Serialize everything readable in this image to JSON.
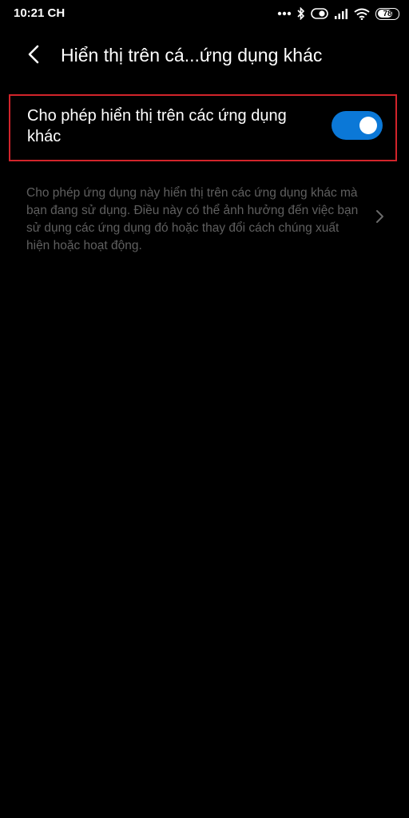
{
  "status_bar": {
    "time": "10:21 CH",
    "battery_level": "78",
    "battery_fraction": 0.78,
    "icons": [
      "more-dots-icon",
      "bluetooth-icon",
      "alarm-toggle-icon",
      "signal-icon",
      "wifi-icon",
      "battery-icon"
    ]
  },
  "header": {
    "back_icon": "chevron-left-icon",
    "title": "Hiển thị trên cá...ứng dụng khác"
  },
  "setting": {
    "label": "Cho phép hiển thị trên các ứng dụng khác",
    "toggle_on": true,
    "toggle_color": "#0b78d7",
    "highlight_color": "#d2242b"
  },
  "description": {
    "text": "Cho phép ứng dụng này hiển thị trên các ứng dụng khác mà bạn đang sử dụng. Điều này có thể ảnh hưởng đến việc bạn sử dụng các ứng dụng đó hoặc thay đổi cách chúng xuất hiện hoặc hoạt động.",
    "icon": "chevron-right-icon"
  }
}
